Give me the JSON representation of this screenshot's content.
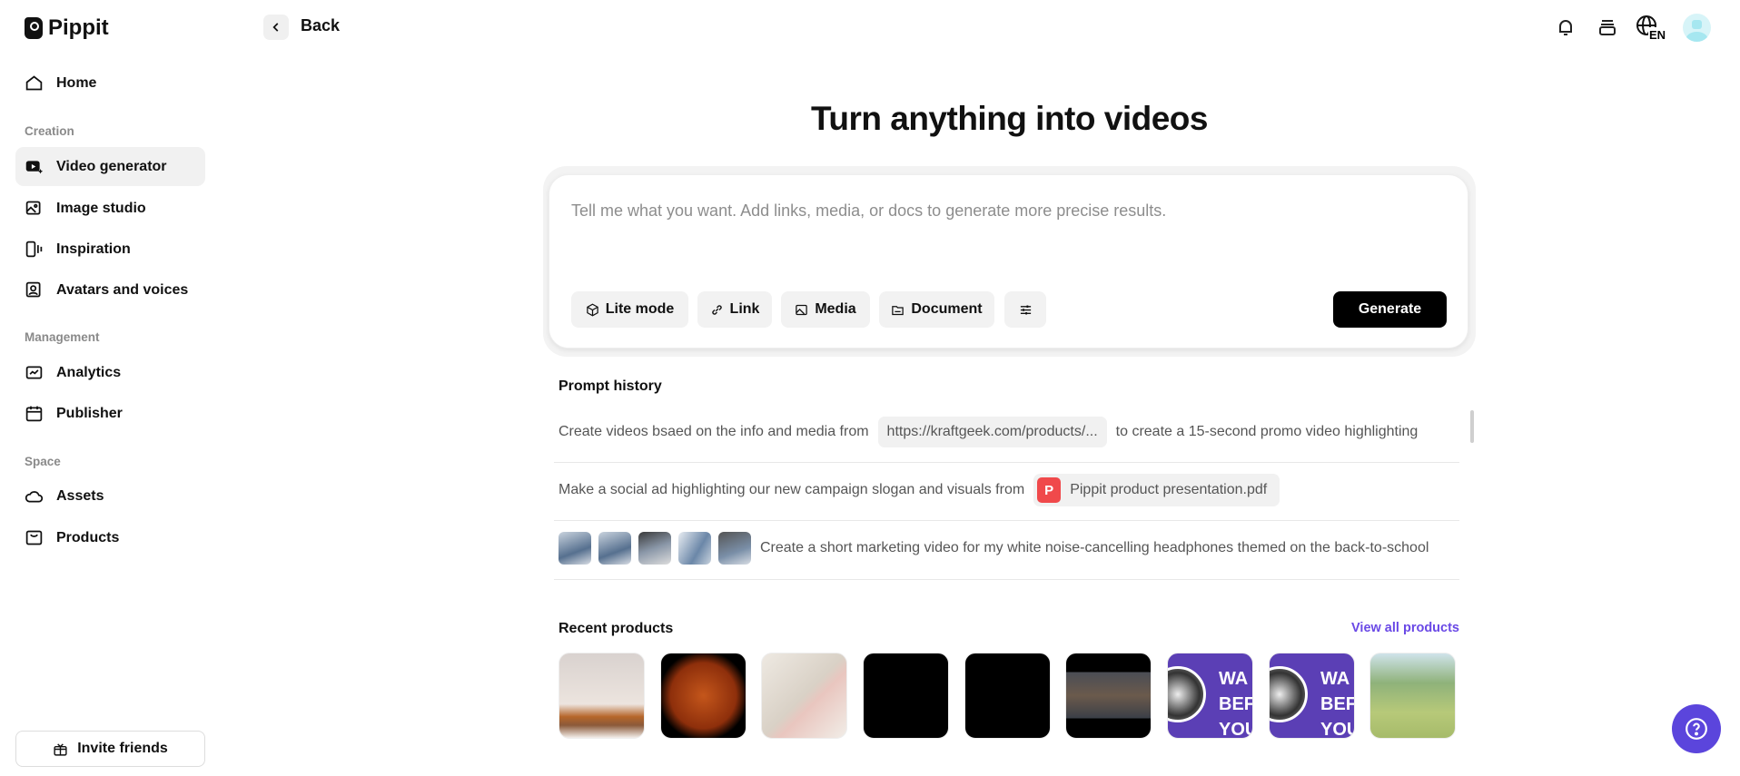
{
  "app": {
    "name": "Pippit"
  },
  "header": {
    "back_label": "Back",
    "language": "EN"
  },
  "sidebar": {
    "home": "Home",
    "sections": [
      {
        "label": "Creation",
        "items": [
          "Video generator",
          "Image studio",
          "Inspiration",
          "Avatars and voices"
        ]
      },
      {
        "label": "Management",
        "items": [
          "Analytics",
          "Publisher"
        ]
      },
      {
        "label": "Space",
        "items": [
          "Assets",
          "Products"
        ]
      }
    ],
    "active": "Video generator",
    "invite_label": "Invite friends"
  },
  "main": {
    "title": "Turn anything into videos",
    "prompt_placeholder": "Tell me what you want. Add links, media, or docs to generate more precise results.",
    "tools": [
      "Lite mode",
      "Link",
      "Media",
      "Document"
    ],
    "generate_label": "Generate",
    "prompt_history": {
      "label": "Prompt history",
      "rows": [
        {
          "before": "Create videos bsaed on the info and media from",
          "chip": "https://kraftgeek.com/products/...",
          "after": "to create a 15-second promo video highlighting"
        },
        {
          "before": "Make a social ad highlighting our new campaign slogan and visuals from",
          "file_icon": "P",
          "file": "Pippit product presentation.pdf"
        },
        {
          "text": "Create a short marketing video for my white noise-cancelling headphones themed on the back-to-school"
        }
      ]
    },
    "recent_products": {
      "label": "Recent products",
      "view_all": "View all products",
      "thumb_text": "WA BEF YOU"
    }
  },
  "colors": {
    "accent": "#6a49e6",
    "help": "#5b45dc",
    "pdf": "#f0494b"
  }
}
